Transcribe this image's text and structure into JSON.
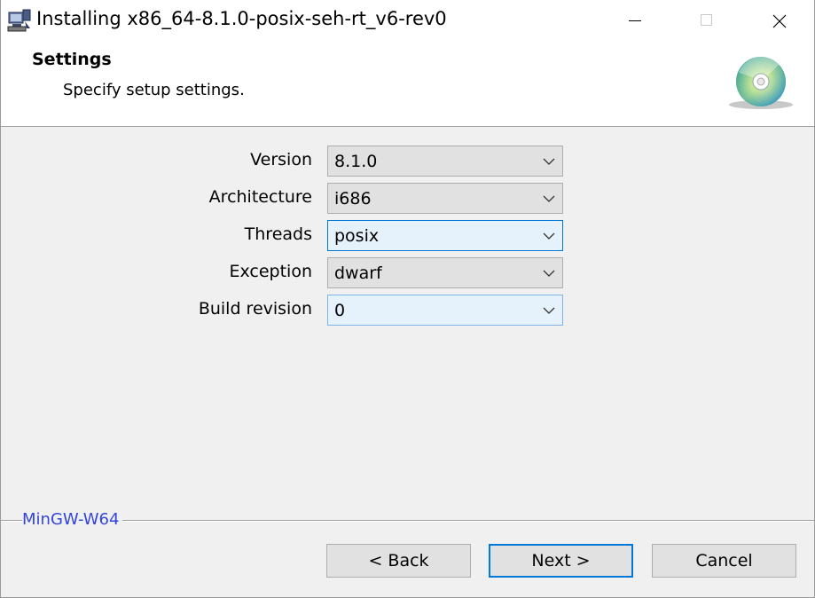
{
  "window": {
    "title": "Installing x86_64-8.1.0-posix-seh-rt_v6-rev0"
  },
  "header": {
    "title": "Settings",
    "subtitle": "Specify setup settings."
  },
  "settings": [
    {
      "label": "Version",
      "value": "8.1.0"
    },
    {
      "label": "Architecture",
      "value": "i686"
    },
    {
      "label": "Threads",
      "value": "posix"
    },
    {
      "label": "Exception",
      "value": "dwarf"
    },
    {
      "label": "Build revision",
      "value": "0"
    }
  ],
  "footer": {
    "brand": "MinGW-W64",
    "back_label": "< Back",
    "next_label": "Next >",
    "cancel_label": "Cancel"
  },
  "colors": {
    "accent": "#0078d7",
    "brand_text": "#3344dd"
  }
}
